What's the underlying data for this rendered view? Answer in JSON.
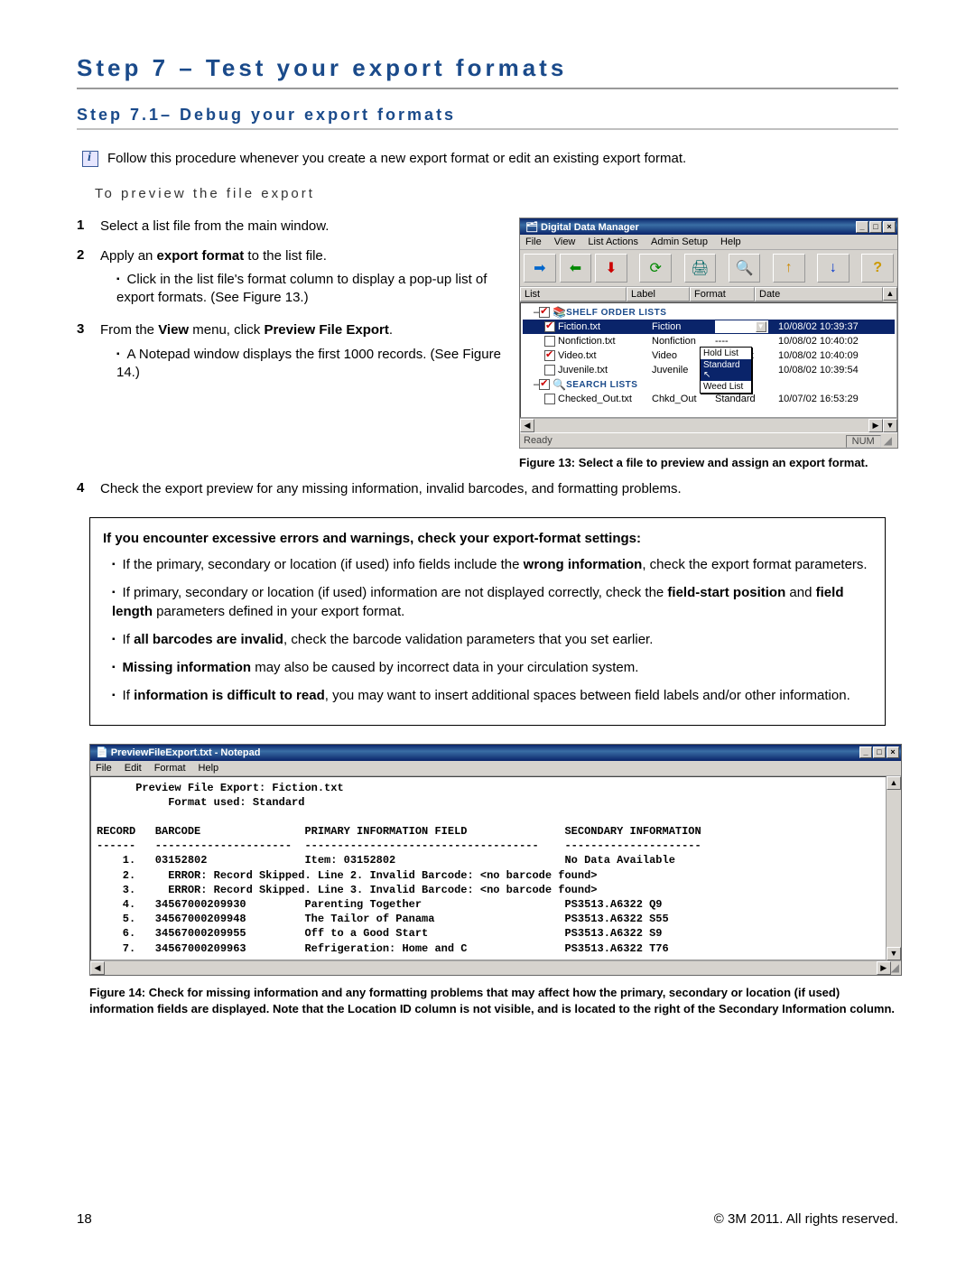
{
  "headings": {
    "h1": "Step 7 – Test your export formats",
    "h2": "Step 7.1– Debug your export formats"
  },
  "info_note": "Follow this procedure whenever you create a new export format or edit an existing export format.",
  "subhead_preview": "To preview the file export",
  "steps": {
    "s1": "Select a list file from the main window.",
    "s2_a": "Apply an ",
    "s2_b": "export format",
    "s2_c": " to the list file.",
    "s2_sub": "Click in the list file's format column to display a pop-up list of export formats. (See Figure 13.)",
    "s3_a": "From the ",
    "s3_b": "View",
    "s3_c": " menu, click ",
    "s3_d": "Preview File Export",
    "s3_e": ".",
    "s3_sub": "A Notepad window displays the first 1000 records. (See Figure 14.)",
    "s4": "Check the export preview for any missing information, invalid barcodes, and formatting problems."
  },
  "fig13_caption": "Figure 13: Select a file to preview and assign an export format.",
  "ddm": {
    "title": "Digital Data Manager",
    "menu": [
      "File",
      "View",
      "List Actions",
      "Admin Setup",
      "Help"
    ],
    "headers": [
      "List",
      "Label",
      "Format",
      "Date"
    ],
    "group1": "SHELF ORDER LISTS",
    "group2": "SEARCH LISTS",
    "rows": [
      {
        "checked": true,
        "name": "Fiction.txt",
        "label": "Fiction",
        "format": "Standard",
        "date": "10/08/02 10:39:37",
        "selected": true,
        "dropdown": true
      },
      {
        "checked": false,
        "name": "Nonfiction.txt",
        "label": "Nonfiction",
        "format": "----",
        "date": "10/08/02 10:40:02"
      },
      {
        "checked": true,
        "name": "Video.txt",
        "label": "Video",
        "format": "Hold List",
        "date": "10/08/02 10:40:09"
      },
      {
        "checked": false,
        "name": "Juvenile.txt",
        "label": "Juvenile",
        "format": "----",
        "date": "10/08/02 10:39:54"
      }
    ],
    "row_checked_out": {
      "name": "Checked_Out.txt",
      "label": "Chkd_Out",
      "format": "Standard",
      "date": "10/07/02 16:53:29"
    },
    "popup": [
      "Hold List",
      "Standard",
      "Weed List"
    ],
    "status_ready": "Ready",
    "status_num": "NUM"
  },
  "box": {
    "lead": "If you encounter excessive errors and warnings, check your export-format settings:",
    "b1a": "If the primary, secondary or location (if used) info fields include the ",
    "b1b": "wrong information",
    "b1c": ", check the export format parameters.",
    "b2a": "If primary, secondary or location (if used) information are not displayed correctly, check the ",
    "b2b": "field-start position",
    "b2c": " and ",
    "b2d": "field length",
    "b2e": " parameters defined in your export format.",
    "b3a": "If ",
    "b3b": "all barcodes are invalid",
    "b3c": ", check the barcode validation parameters that you set earlier.",
    "b4a": "Missing information",
    "b4b": " may also be caused by incorrect data in your circulation system.",
    "b5a": "If ",
    "b5b": "information is difficult to read",
    "b5c": ", you may want to insert additional spaces between field labels and/or other information."
  },
  "notepad": {
    "title": "PreviewFileExport.txt - Notepad",
    "menu": [
      "File",
      "Edit",
      "Format",
      "Help"
    ],
    "body": "      Preview File Export: Fiction.txt\n           Format used: Standard\n\nRECORD   BARCODE                PRIMARY INFORMATION FIELD               SECONDARY INFORMATION\n------   ---------------------  ------------------------------------    ---------------------\n    1.   03152802               Item: 03152802                          No Data Available\n    2.     ERROR: Record Skipped. Line 2. Invalid Barcode: <no barcode found>\n    3.     ERROR: Record Skipped. Line 3. Invalid Barcode: <no barcode found>\n    4.   34567000209930         Parenting Together                      PS3513.A6322 Q9\n    5.   34567000209948         The Tailor of Panama                    PS3513.A6322 S55\n    6.   34567000209955         Off to a Good Start                     PS3513.A6322 S9\n    7.   34567000209963         Refrigeration: Home and C               PS3513.A6322 T76"
  },
  "fig14_caption": "Figure 14: Check for missing information and any formatting problems that may affect how the primary, secondary or location (if used) information fields are displayed. Note that the Location ID column is not visible, and is located to the right of the Secondary Information column.",
  "footer": {
    "page": "18",
    "copyright": "© 3M 2011. All rights reserved."
  }
}
